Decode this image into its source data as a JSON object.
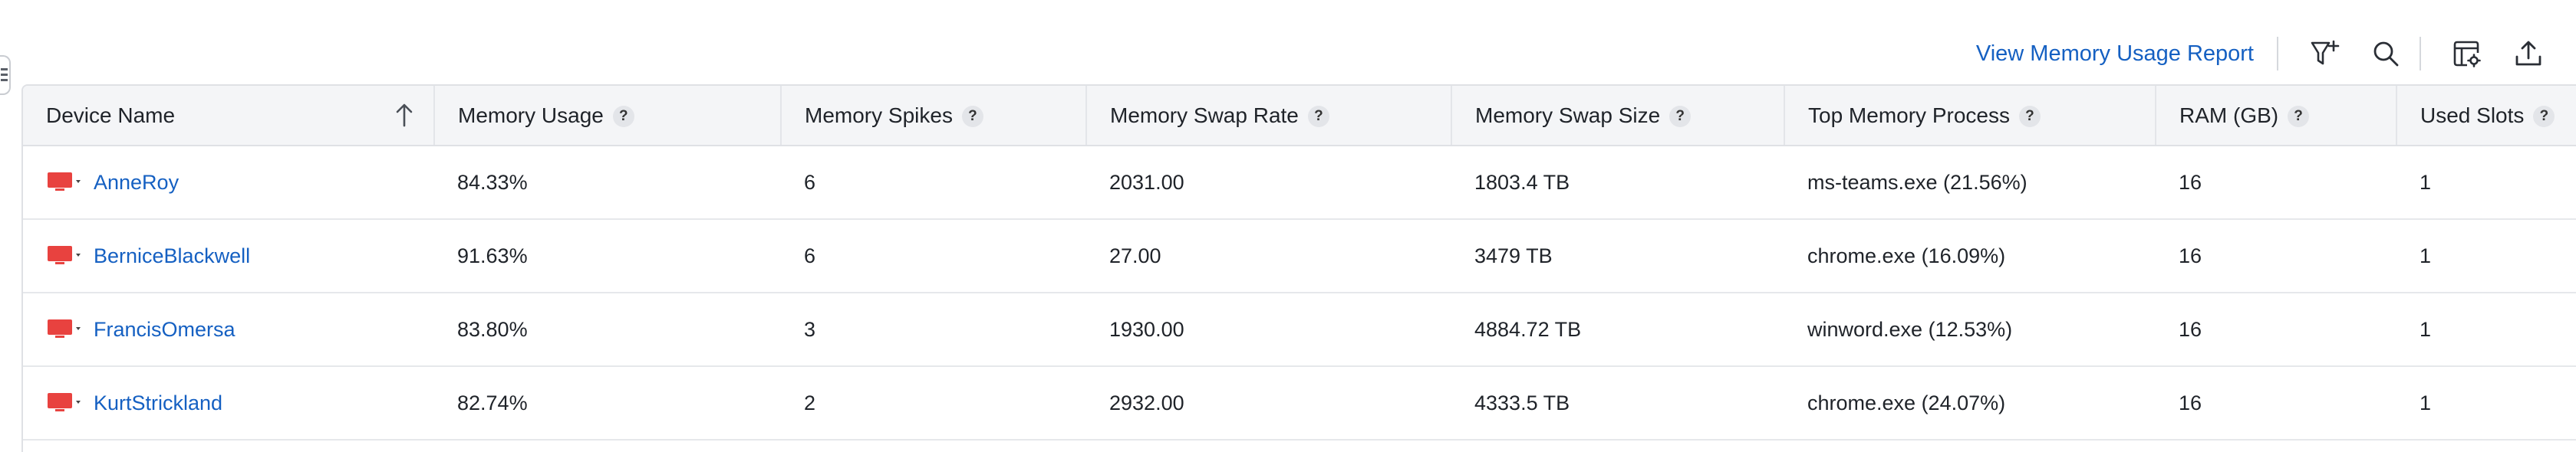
{
  "toolbar": {
    "report_link": "View Memory Usage Report",
    "icons": [
      "filter-add-icon",
      "search-icon",
      "column-settings-icon",
      "export-icon"
    ]
  },
  "table": {
    "columns": [
      {
        "label": "Device Name",
        "help": false
      },
      {
        "label": "Memory Usage",
        "help": true
      },
      {
        "label": "Memory Spikes",
        "help": true
      },
      {
        "label": "Memory Swap Rate",
        "help": true
      },
      {
        "label": "Memory Swap Size",
        "help": true
      },
      {
        "label": "Top Memory Process",
        "help": true
      },
      {
        "label": "RAM (GB)",
        "help": true
      },
      {
        "label": "Used Slots",
        "help": true
      }
    ],
    "help_glyph": "?",
    "rows": [
      [
        "AnneRoy",
        "84.33%",
        "6",
        "2031.00",
        "1803.4 TB",
        "ms-teams.exe (21.56%)",
        "16",
        "1"
      ],
      [
        "BerniceBlackwell",
        "91.63%",
        "6",
        "27.00",
        "3479 TB",
        "chrome.exe (16.09%)",
        "16",
        "1"
      ],
      [
        "FrancisOmersa",
        "83.80%",
        "3",
        "1930.00",
        "4884.72 TB",
        "winword.exe (12.53%)",
        "16",
        "1"
      ],
      [
        "KurtStrickland",
        "82.74%",
        "2",
        "2932.00",
        "4333.5 TB",
        "chrome.exe (24.07%)",
        "16",
        "1"
      ]
    ]
  },
  "colors": {
    "link": "#1560c2",
    "device_icon": "#e8423f",
    "header_bg": "#f4f5f7"
  }
}
